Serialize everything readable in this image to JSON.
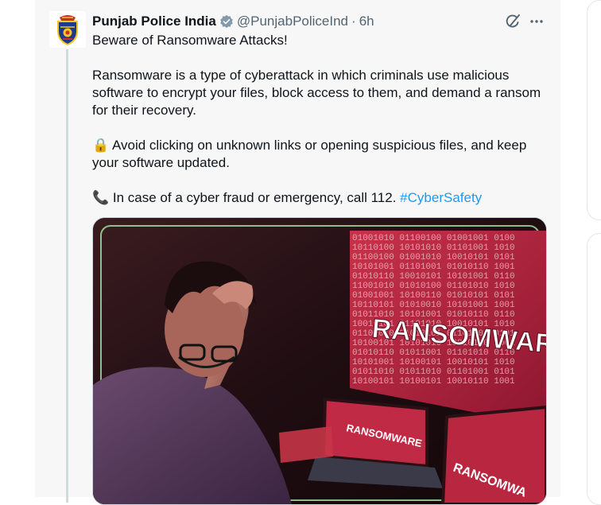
{
  "tweet": {
    "author_name": "Punjab Police India",
    "handle": "@PunjabPoliceInd",
    "separator": "·",
    "time": "6h",
    "line1": "Beware of Ransomware Attacks!",
    "line2": "Ransomware is a type of cyberattack in which criminals use malicious software to encrypt your files, block access to them, and demand a ransom for their recovery.",
    "line3": "🔒 Avoid clicking on unknown links or opening suspicious files, and keep your software updated.",
    "line4_prefix": "📞 In case of a cyber fraud or emergency, call 112. ",
    "hashtag": "#CyberSafety",
    "icons": {
      "verified": "verified-badge-icon",
      "grok": "grok-explain-icon",
      "more": "more-options-icon"
    },
    "colors": {
      "accent": "#1d9bf0",
      "secondary_text": "#536471",
      "primary_text": "#0f1419"
    }
  },
  "media": {
    "screen_text_main": "RANSOMWARE",
    "screen_text_laptop": "RANSOMWARE",
    "screen_text_right": "RANSOMWA",
    "binary_rows": [
      "01001010 01100100 01001001 0100",
      "10110100 10101010 01101001 1010",
      "01100100 01001010 10010101 0101",
      "10101001 01101001 01010110 1001",
      "01010110 10010101 10101001 0110",
      "11001010 01010100 01101010 1010",
      "01001001 10100110 01010101 0101",
      "10110101 01010010 10101001 1001",
      "01011010 10101001 01010110 0110",
      "10010101 01101010 10010101 1010",
      "01101010 01010101 01101001 0101",
      "10100101 10101010 10010110 1001",
      "01010110 01011001 01101010 0110",
      "10101001 10100101 10010101 1010",
      "01011010 01011010 01101001 0101",
      "10100101 10100101 10010110 1001"
    ]
  }
}
